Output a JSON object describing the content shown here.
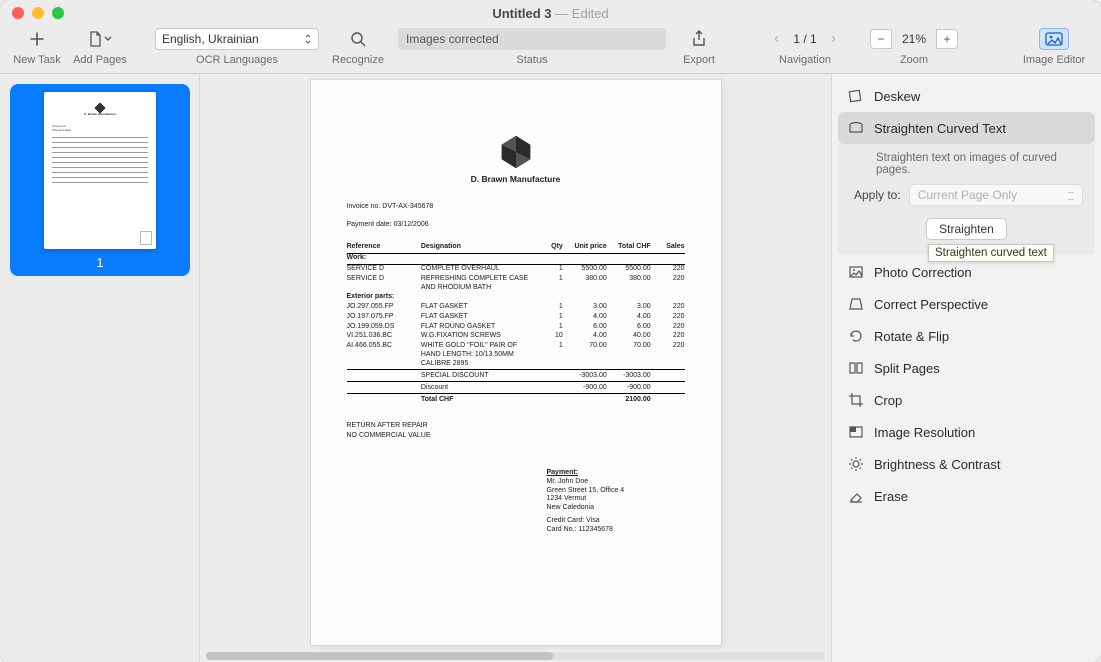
{
  "window": {
    "title": "Untitled 3",
    "state": "Edited"
  },
  "toolbar": {
    "newTask": "New Task",
    "addPages": "Add Pages",
    "ocrLanguagesLabel": "OCR Languages",
    "ocrLanguagesValue": "English, Ukrainian",
    "recognize": "Recognize",
    "statusLabel": "Status",
    "statusValue": "Images corrected",
    "export": "Export",
    "navigationLabel": "Navigation",
    "navigationValue": "1 / 1",
    "zoomLabel": "Zoom",
    "zoomValue": "21%",
    "imageEditor": "Image Editor"
  },
  "thumbnails": {
    "page1": "1"
  },
  "document": {
    "company": "D. Brawn Manufacture",
    "invoiceLine": "Invoice no. DVT-AX-345678",
    "paymentDate": "Payment date: 03/12/2006",
    "headers": {
      "reference": "Reference",
      "designation": "Designation",
      "qty": "Qty",
      "unitPrice": "Unit price",
      "totalCHF": "Total CHF",
      "sales": "Sales"
    },
    "sectionWork": "Work:",
    "rows": [
      {
        "ref": "SERVICE D",
        "des": "COMPLETE OVERHAUL",
        "qty": "1",
        "up": "5500.00",
        "tot": "5500.00",
        "s": "220"
      },
      {
        "ref": "SERVICE D",
        "des": "REFRESHING COMPLETE CASE AND RHODIUM BATH",
        "qty": "1",
        "up": "380.00",
        "tot": "380.00",
        "s": "220"
      }
    ],
    "sectionParts": "Exterior parts:",
    "parts": [
      {
        "ref": "JO.297.055.FP",
        "des": "FLAT GASKET",
        "qty": "1",
        "up": "3.00",
        "tot": "3.00",
        "s": "220"
      },
      {
        "ref": "JO.197.075.FP",
        "des": "FLAT GASKET",
        "qty": "1",
        "up": "4.00",
        "tot": "4.00",
        "s": "220"
      },
      {
        "ref": "JO.199.059.DS",
        "des": "FLAT ROUND GASKET",
        "qty": "1",
        "up": "6.00",
        "tot": "6.00",
        "s": "220"
      },
      {
        "ref": "VI.251.036.BC",
        "des": "W.G.FIXATION SCREWS",
        "qty": "10",
        "up": "4.00",
        "tot": "40.00",
        "s": "220"
      },
      {
        "ref": "AI.466.055.BC",
        "des": "WHITE GOLD \"FOIL\" PAIR OF HAND LENGTH: 10/13.50MM CALIBRE 2895",
        "qty": "1",
        "up": "70.00",
        "tot": "70.00",
        "s": "220"
      }
    ],
    "specialDiscount": {
      "label": "SPECIAL DISCOUNT",
      "v1": "-3003.00",
      "v2": "-3003.00"
    },
    "discount": {
      "label": "Discount",
      "v1": "-900.00",
      "v2": "-900.00"
    },
    "total": {
      "label": "Total CHF",
      "v": "2100.00"
    },
    "return": "RETURN AFTER REPAIR",
    "noValue": "NO COMMERCIAL VALUE",
    "payment": {
      "title": "Payment:",
      "name": "Mr. John Doe",
      "addr1": "Green Street 15, Office 4",
      "addr2": "1234 Vermut",
      "addr3": "New Caledonia",
      "card1": "Credit Card: Visa",
      "card2": "Card No.: 112345678"
    }
  },
  "sidebar": {
    "deskew": "Deskew",
    "straighten": "Straighten Curved Text",
    "straightenDesc": "Straighten text on images of curved pages.",
    "applyTo": "Apply to:",
    "applyToValue": "Current Page Only",
    "straightenBtn": "Straighten",
    "tooltip": "Straighten curved text",
    "photo": "Photo Correction",
    "perspective": "Correct Perspective",
    "rotate": "Rotate & Flip",
    "split": "Split Pages",
    "crop": "Crop",
    "resolution": "Image Resolution",
    "brightness": "Brightness & Contrast",
    "erase": "Erase"
  }
}
